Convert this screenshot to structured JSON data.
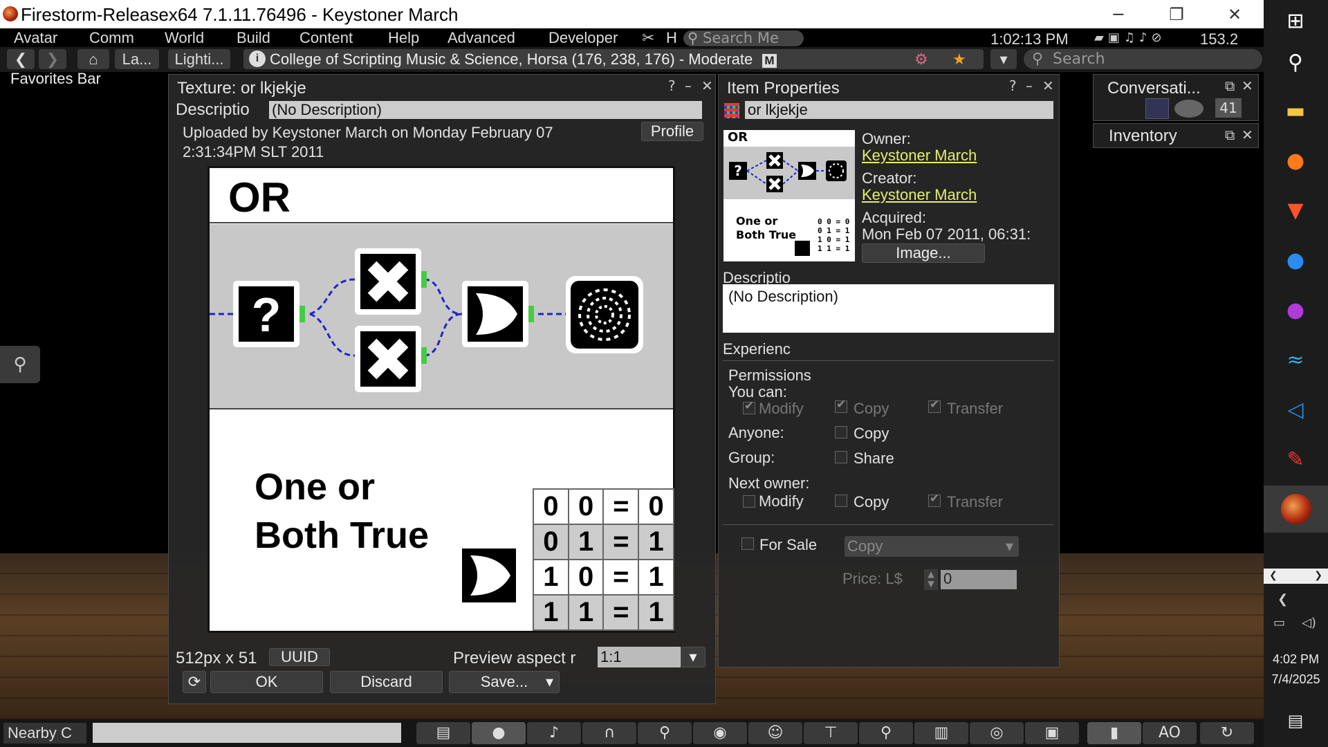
{
  "window": {
    "title": "Firestorm-Releasex64 7.1.11.76496 - Keystoner March"
  },
  "menu": {
    "items": [
      "Avatar",
      "Comm",
      "World",
      "Build",
      "Content",
      "Help",
      "Advanced",
      "Developer"
    ],
    "h_label": "H",
    "search_placeholder": "Search Me",
    "clock": "1:02:13 PM",
    "fps": "153.2"
  },
  "nav": {
    "landmark_btn": "La...",
    "lighting_btn": "Lighti...",
    "location": "College of Scripting Music & Science, Horsa (176, 238, 176) - Moderate",
    "maturity_badge": "M",
    "search_placeholder": "Search"
  },
  "favorites_bar": "Favorites Bar",
  "texture_floater": {
    "title": "Texture: or lkjekje",
    "description_label": "Descriptio",
    "description_value": "(No Description)",
    "uploaded": "Uploaded by Keystoner March on Monday February 07 2:31:34PM SLT 2011",
    "profile_btn": "Profile",
    "size_label": "512px x 51",
    "uuid_btn": "UUID",
    "aspect_label": "Preview aspect r",
    "aspect_value": "1:1",
    "ok_btn": "OK",
    "discard_btn": "Discard",
    "save_btn": "Save...",
    "image": {
      "heading": "OR",
      "caption_line1": "One or",
      "caption_line2": "Both True",
      "truth_table": [
        [
          "0",
          "0",
          "=",
          "0"
        ],
        [
          "0",
          "1",
          "=",
          "1"
        ],
        [
          "1",
          "0",
          "=",
          "1"
        ],
        [
          "1",
          "1",
          "=",
          "1"
        ]
      ]
    }
  },
  "item_properties": {
    "title": "Item Properties",
    "name": "or lkjekje",
    "thumb": {
      "heading": "OR",
      "caption_line1": "One or",
      "caption_line2": "Both True"
    },
    "owner_label": "Owner:",
    "owner": "Keystoner March",
    "creator_label": "Creator:",
    "creator": "Keystoner March",
    "acquired_label": "Acquired:",
    "acquired": "Mon Feb 07 2011, 06:31:",
    "image_btn": "Image...",
    "description_label": "Descriptio",
    "description_value": "(No Description)",
    "experience_label": "Experienc",
    "permissions_label": "Permissions",
    "you_can_label": "You can:",
    "modify_label": "Modify",
    "copy_label": "Copy",
    "transfer_label": "Transfer",
    "anyone_label": "Anyone:",
    "group_label": "Group:",
    "share_label": "Share",
    "next_owner_label": "Next owner:",
    "for_sale_label": "For Sale",
    "sale_type": "Copy",
    "price_label": "Price: L$",
    "price_value": "0"
  },
  "conversations": {
    "title": "Conversati...",
    "count": "41"
  },
  "inventory": {
    "title": "Inventory"
  },
  "bottom": {
    "nearby_chat": "Nearby C",
    "ao_label": "AO"
  },
  "taskbar": {
    "time": "4:02 PM",
    "date": "7/4/2025"
  }
}
